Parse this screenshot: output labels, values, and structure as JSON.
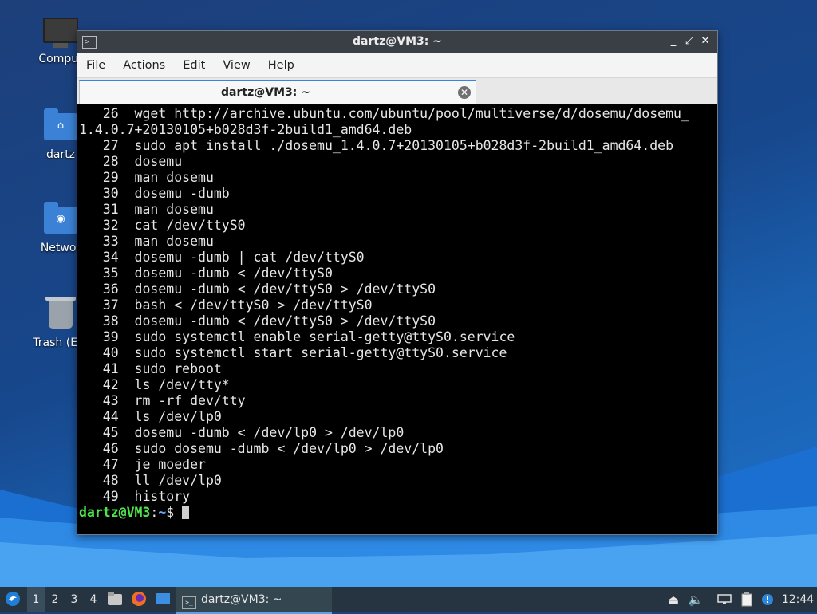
{
  "desktop": {
    "icons": [
      {
        "label": "Comput",
        "icon": "computer-icon"
      },
      {
        "label": "dartz",
        "icon": "home-folder-icon"
      },
      {
        "label": "Networ",
        "icon": "network-folder-icon"
      },
      {
        "label": "Trash (Em",
        "icon": "trash-icon"
      }
    ]
  },
  "window": {
    "title": "dartz@VM3: ~",
    "controls": {
      "minimize": "_",
      "maximize": "⤢",
      "close": "✕"
    },
    "menu": [
      "File",
      "Actions",
      "Edit",
      "View",
      "Help"
    ],
    "tab": {
      "label": "dartz@VM3: ~",
      "close": "✕"
    }
  },
  "terminal": {
    "lines": [
      "   26  wget http://archive.ubuntu.com/ubuntu/pool/multiverse/d/dosemu/dosemu_",
      "1.4.0.7+20130105+b028d3f-2build1_amd64.deb",
      "   27  sudo apt install ./dosemu_1.4.0.7+20130105+b028d3f-2build1_amd64.deb",
      "   28  dosemu",
      "   29  man dosemu",
      "   30  dosemu -dumb",
      "   31  man dosemu",
      "   32  cat /dev/ttyS0",
      "   33  man dosemu",
      "   34  dosemu -dumb | cat /dev/ttyS0",
      "   35  dosemu -dumb < /dev/ttyS0",
      "   36  dosemu -dumb < /dev/ttyS0 > /dev/ttyS0",
      "   37  bash < /dev/ttyS0 > /dev/ttyS0",
      "   38  dosemu -dumb < /dev/ttyS0 > /dev/ttyS0",
      "   39  sudo systemctl enable serial-getty@ttyS0.service",
      "   40  sudo systemctl start serial-getty@ttyS0.service",
      "   41  sudo reboot",
      "   42  ls /dev/tty*",
      "   43  rm -rf dev/tty",
      "   44  ls /dev/lp0",
      "   45  dosemu -dumb < /dev/lp0 > /dev/lp0",
      "   46  sudo dosemu -dumb < /dev/lp0 > /dev/lp0",
      "   47  je moeder",
      "   48  ll /dev/lp0",
      "   49  history"
    ],
    "prompt": {
      "user_host": "dartz@VM3",
      "sep": ":",
      "path": "~",
      "symbol": "$ "
    }
  },
  "taskbar": {
    "workspaces": [
      "1",
      "2",
      "3",
      "4"
    ],
    "active_workspace": "1",
    "launchers": [
      "menu-icon",
      "file-manager-icon",
      "firefox-icon",
      "show-desktop-icon"
    ],
    "app_button": "dartz@VM3: ~",
    "tray": [
      "eject-icon",
      "volume-icon",
      "network-icon",
      "clipboard-icon",
      "update-notifier-icon"
    ],
    "clock": "12:44"
  },
  "colors": {
    "prompt_user": "#4ee44e",
    "prompt_path": "#6fa3ff",
    "taskbar": "#253440",
    "titlebar": "#3a3f46"
  }
}
